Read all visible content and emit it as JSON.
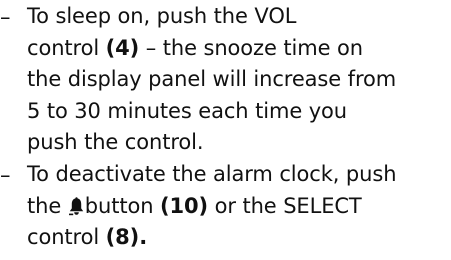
{
  "bullets": [
    {
      "marker": "–",
      "lines": [
        [
          "To sleep on, push the VOL"
        ],
        [
          "control ",
          "(4)",
          " – the snooze time on"
        ],
        [
          "the display panel will increase from"
        ],
        [
          "5 to 30 minutes each time you"
        ],
        [
          "push the control."
        ]
      ]
    },
    {
      "marker": "–",
      "lines": [
        [
          "To deactivate the alarm clock, push"
        ],
        [
          "the ",
          "button ",
          "(10)",
          " or the SELECT"
        ],
        [
          "control ",
          "(8)",
          "."
        ]
      ]
    }
  ],
  "icons": {
    "alarm_bell": "bell-icon"
  }
}
